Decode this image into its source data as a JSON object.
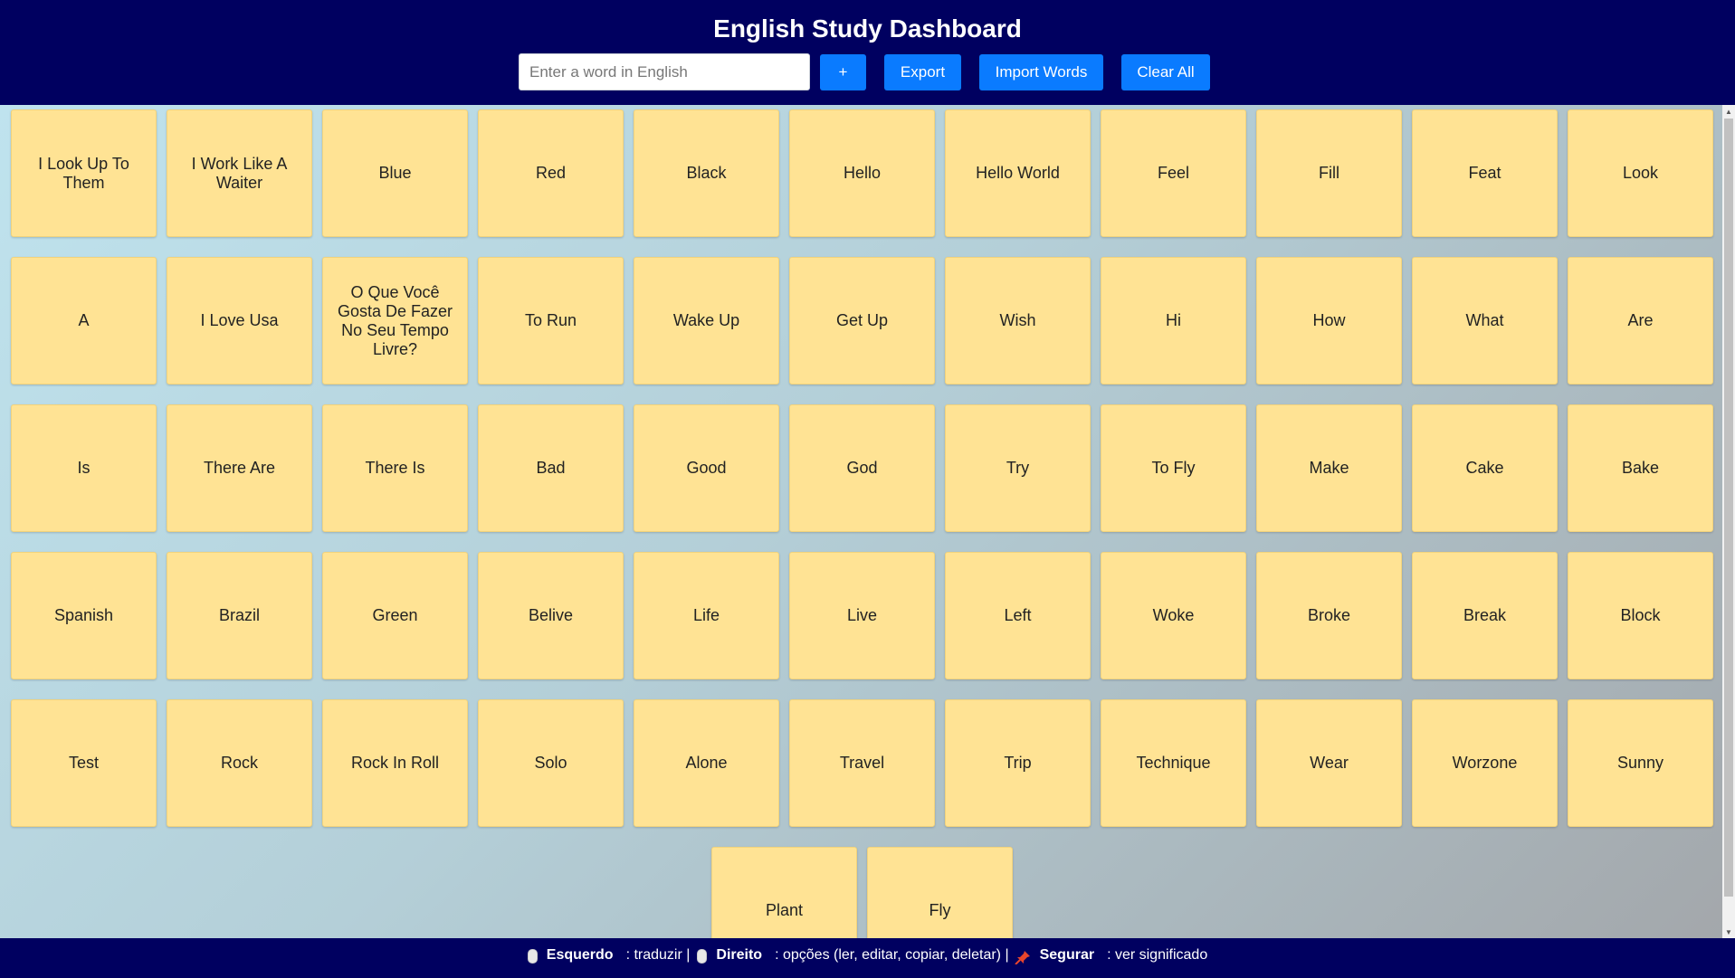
{
  "header": {
    "title": "English Study Dashboard",
    "input_placeholder": "Enter a word in English",
    "add_label": "+",
    "export_label": "Export",
    "import_label": "Import Words",
    "clear_label": "Clear All"
  },
  "words": [
    "I Look Up To Them",
    "I Work Like A Waiter",
    "Blue",
    "Red",
    "Black",
    "Hello",
    "Hello World",
    "Feel",
    "Fill",
    "Feat",
    "Look",
    "A",
    "I Love Usa",
    "O Que Você Gosta De Fazer No Seu Tempo Livre?",
    "To Run",
    "Wake Up",
    "Get Up",
    "Wish",
    "Hi",
    "How",
    "What",
    "Are",
    "Is",
    "There Are",
    "There Is",
    "Bad",
    "Good",
    "God",
    "Try",
    "To Fly",
    "Make",
    "Cake",
    "Bake",
    "Spanish",
    "Brazil",
    "Green",
    "Belive",
    "Life",
    "Live",
    "Left",
    "Woke",
    "Broke",
    "Break",
    "Block",
    "Test",
    "Rock",
    "Rock In Roll",
    "Solo",
    "Alone",
    "Travel",
    "Trip",
    "Technique",
    "Wear",
    "Worzone",
    "Sunny",
    "Plant",
    "Fly"
  ],
  "footer": {
    "left_label": "Esquerdo",
    "left_action": ": traduzir |",
    "right_label": "Direito",
    "right_action": ": opções (ler, editar, copiar, deletar) |",
    "hold_label": "Segurar",
    "hold_action": ": ver significado"
  },
  "colors": {
    "header_bg": "#000060",
    "button_bg": "#0a7bff",
    "card_bg": "#ffe394"
  },
  "icons": {
    "mouse": "mouse-icon",
    "pin": "pin-icon"
  }
}
